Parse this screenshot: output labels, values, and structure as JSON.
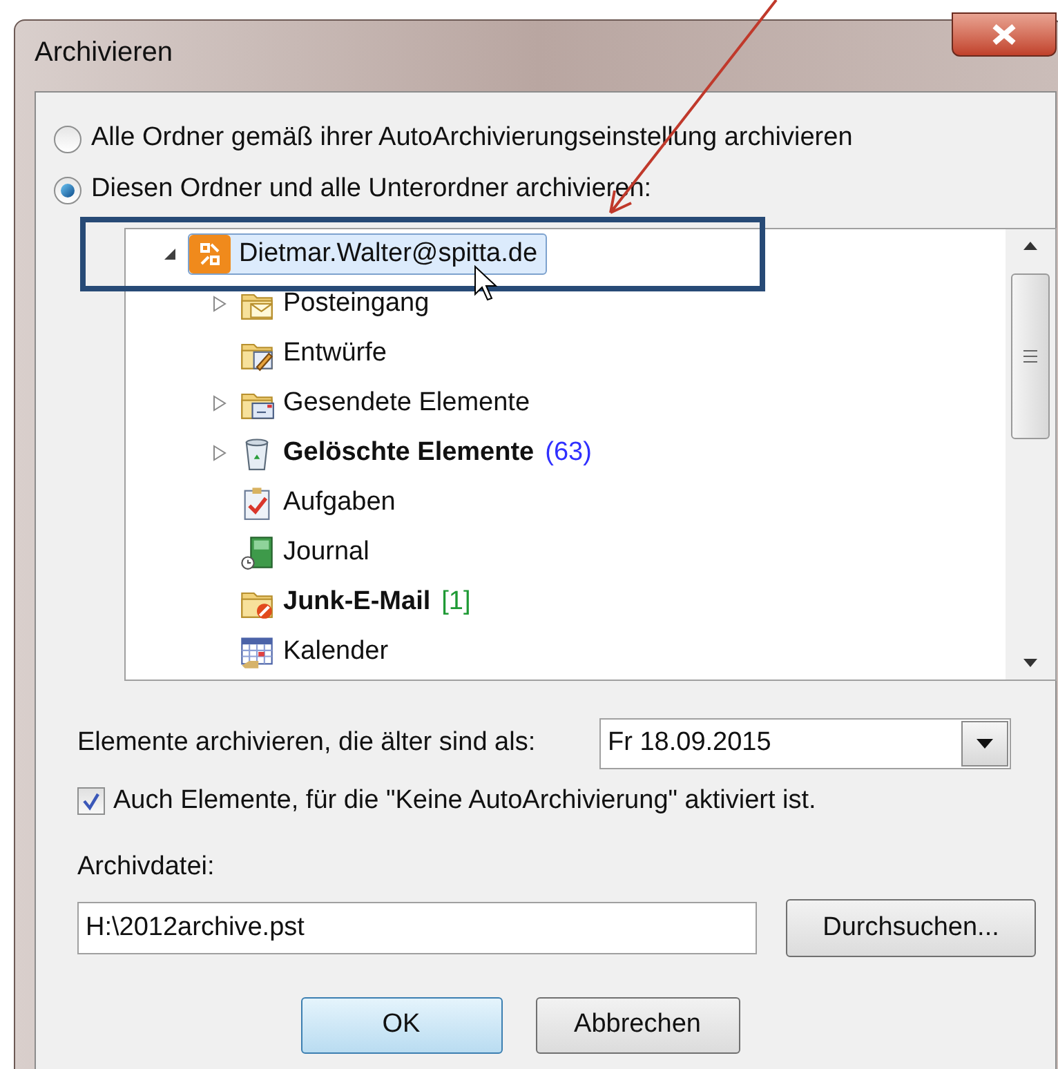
{
  "window": {
    "title": "Archivieren"
  },
  "scope_options": [
    {
      "label": "Alle Ordner gemäß ihrer AutoArchivierungseinstellung archivieren",
      "selected": false
    },
    {
      "label": "Diesen Ordner und alle Unterordner archivieren:",
      "selected": true
    }
  ],
  "folder_tree": {
    "label": "Dietmar.Walter@spitta.de",
    "selected": true,
    "expanded": true,
    "children": [
      {
        "kind": "inbox",
        "label": "Posteingang",
        "expandable": true,
        "bold": false
      },
      {
        "kind": "drafts",
        "label": "Entwürfe",
        "expandable": false,
        "bold": false
      },
      {
        "kind": "sent",
        "label": "Gesendete Elemente",
        "expandable": true,
        "bold": false
      },
      {
        "kind": "deleted",
        "label": "Gelöschte Elemente",
        "expandable": true,
        "bold": true,
        "count": "(63)",
        "color": "#3030ff"
      },
      {
        "kind": "tasks",
        "label": "Aufgaben",
        "expandable": false,
        "bold": false
      },
      {
        "kind": "journal",
        "label": "Journal",
        "expandable": false,
        "bold": false
      },
      {
        "kind": "junk",
        "label": "Junk-E-Mail",
        "expandable": false,
        "bold": true,
        "count": "[1]",
        "color": "#1f9a35"
      },
      {
        "kind": "calendar",
        "label": "Kalender",
        "expandable": false,
        "bold": false
      }
    ]
  },
  "older_than": {
    "label": "Elemente archivieren, die älter sind als:",
    "value": "Fr 18.09.2015"
  },
  "include_no_autoarchive": {
    "label": "Auch Elemente, für die \"Keine AutoArchivierung\" aktiviert ist.",
    "checked": true
  },
  "archive_file": {
    "label": "Archivdatei:",
    "value": "H:\\2012archive.pst",
    "browse_button": "Durchsuchen..."
  },
  "buttons": [
    {
      "label": "OK",
      "default": true
    },
    {
      "label": "Abbrechen",
      "default": false
    }
  ]
}
